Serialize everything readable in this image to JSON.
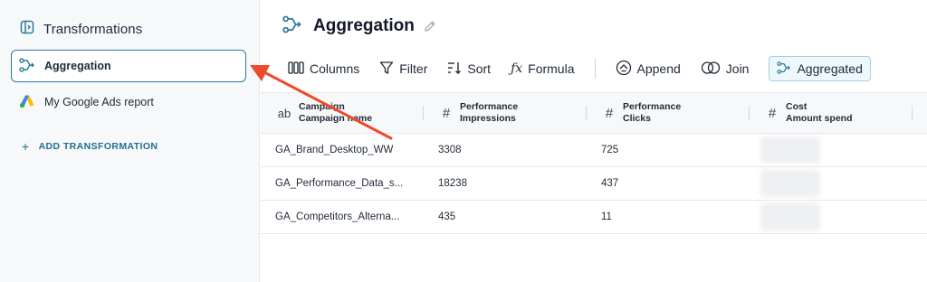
{
  "sidebar": {
    "title": "Transformations",
    "items": [
      {
        "label": "Aggregation",
        "active": true
      },
      {
        "label": "My Google Ads report",
        "active": false
      }
    ],
    "add_label": "ADD TRANSFORMATION"
  },
  "main": {
    "title": "Aggregation",
    "toolbar": {
      "columns": "Columns",
      "filter": "Filter",
      "sort": "Sort",
      "formula": "Formula",
      "append": "Append",
      "join": "Join",
      "aggregated": "Aggregated"
    },
    "table": {
      "headers": [
        {
          "icon": "ab",
          "line1": "Campaign",
          "line2": "Campaign name"
        },
        {
          "icon": "#",
          "line1": "Performance",
          "line2": "Impressions"
        },
        {
          "icon": "#",
          "line1": "Performance",
          "line2": "Clicks"
        },
        {
          "icon": "#",
          "line1": "Cost",
          "line2": "Amount spend"
        }
      ],
      "rows": [
        [
          "GA_Brand_Desktop_WW",
          "3308",
          "725"
        ],
        [
          "GA_Performance_Data_s...",
          "18238",
          "437"
        ],
        [
          "GA_Competitors_Alterna...",
          "435",
          "11"
        ]
      ]
    }
  },
  "colors": {
    "accent": "#2b7a99",
    "arrow": "#ee4b2b",
    "aggregated_bg": "#eef7fb"
  }
}
